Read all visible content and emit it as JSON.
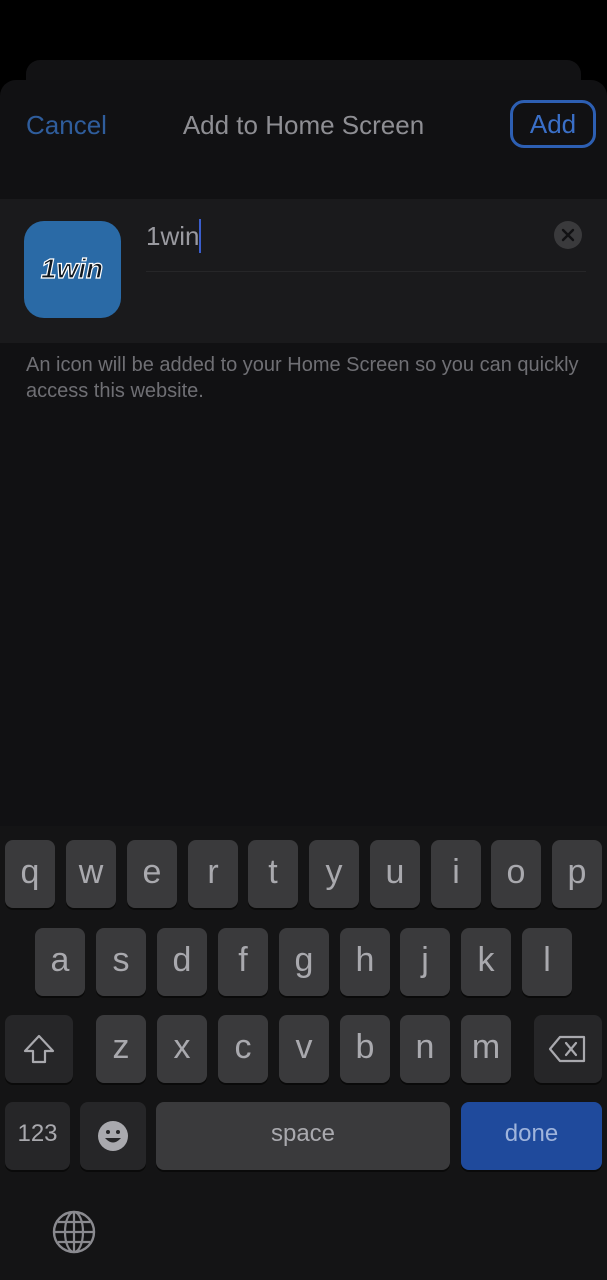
{
  "nav": {
    "cancel": "Cancel",
    "title": "Add to Home Screen",
    "add": "Add"
  },
  "app": {
    "icon_text": "1win",
    "name_value": "1win"
  },
  "hint": "An icon will be added to your Home Screen so you can quickly access this website.",
  "keyboard": {
    "row1": [
      "q",
      "w",
      "e",
      "r",
      "t",
      "y",
      "u",
      "i",
      "o",
      "p"
    ],
    "row2": [
      "a",
      "s",
      "d",
      "f",
      "g",
      "h",
      "j",
      "k",
      "l"
    ],
    "row3": [
      "z",
      "x",
      "c",
      "v",
      "b",
      "n",
      "m"
    ],
    "numbers": "123",
    "space": "space",
    "done": "done"
  },
  "icons": {
    "shift": "shift-icon",
    "backspace": "backspace-icon",
    "emoji": "emoji-icon",
    "globe": "globe-icon",
    "clear": "clear-icon"
  },
  "colors": {
    "accent": "#2f5d9c",
    "done_key": "#1f4a9c",
    "app_icon_bg": "#2a6aa6"
  }
}
